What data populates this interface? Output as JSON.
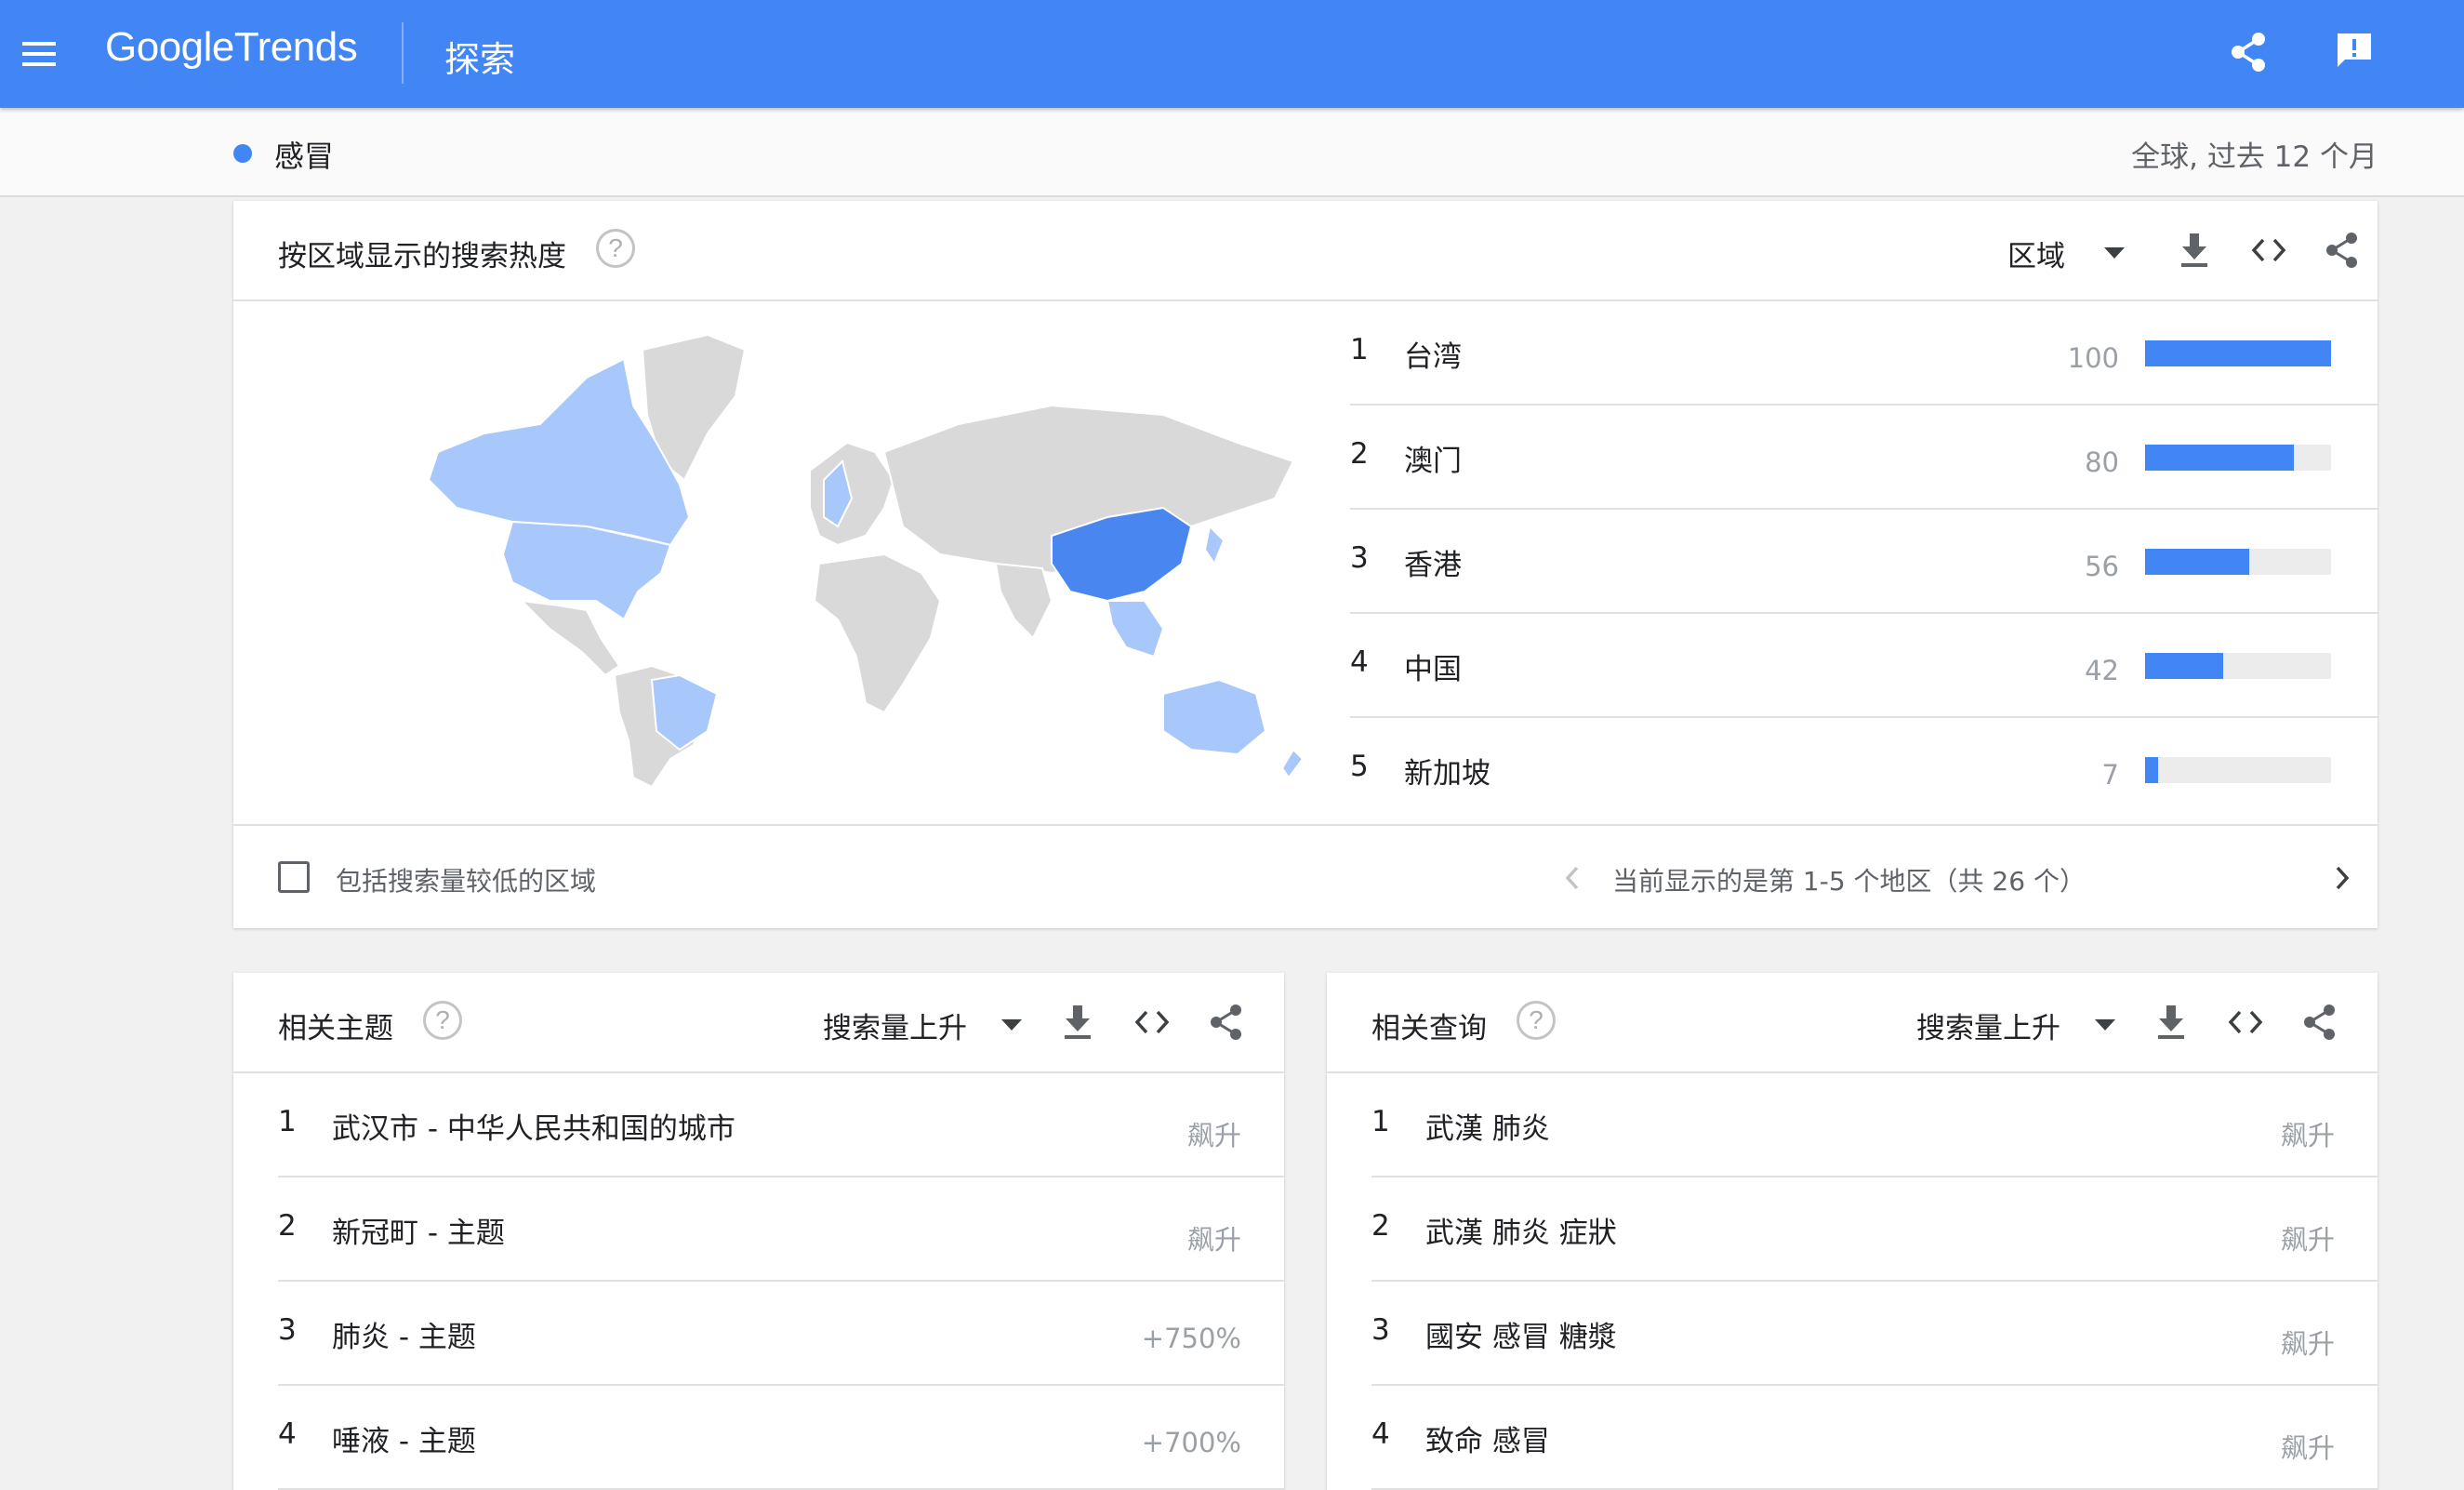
{
  "header": {
    "logo_google": "Google",
    "logo_trends": "Trends",
    "page_title": "探索"
  },
  "comparison": {
    "term": "感冒",
    "term_color": "#4285f4",
    "scope": "全球, 过去 12 个月"
  },
  "region_card": {
    "title": "按区域显示的搜索热度",
    "help": "?",
    "resolution": "区域",
    "map_colors": {
      "high": "#4a86f0",
      "low": "#a8c7fa",
      "none": "#d9d9d9"
    },
    "rows": [
      {
        "rank": "1",
        "name": "台湾",
        "value": "100",
        "level": 100
      },
      {
        "rank": "2",
        "name": "澳门",
        "value": "80",
        "level": 80
      },
      {
        "rank": "3",
        "name": "香港",
        "value": "56",
        "level": 56
      },
      {
        "rank": "4",
        "name": "中国",
        "value": "42",
        "level": 42
      },
      {
        "rank": "5",
        "name": "新加坡",
        "value": "7",
        "level": 7
      }
    ],
    "include_low_volume": "包括搜索量较低的区域",
    "pager": "当前显示的是第 1-5 个地区（共 26 个）"
  },
  "topics_card": {
    "title": "相关主题",
    "help": "?",
    "sort": "搜索量上升",
    "rows": [
      {
        "rank": "1",
        "text": "武汉市 - 中华人民共和国的城市",
        "value": "飙升"
      },
      {
        "rank": "2",
        "text": "新冠町 - 主题",
        "value": "飙升"
      },
      {
        "rank": "3",
        "text": "肺炎 - 主题",
        "value": "+750%"
      },
      {
        "rank": "4",
        "text": "唾液 - 主题",
        "value": "+700%"
      }
    ]
  },
  "queries_card": {
    "title": "相关查询",
    "help": "?",
    "sort": "搜索量上升",
    "rows": [
      {
        "rank": "1",
        "text": "武漢 肺炎",
        "value": "飙升"
      },
      {
        "rank": "2",
        "text": "武漢 肺炎 症狀",
        "value": "飙升"
      },
      {
        "rank": "3",
        "text": "國安 感冒 糖漿",
        "value": "飙升"
      },
      {
        "rank": "4",
        "text": "致命 感冒",
        "value": "飙升"
      }
    ]
  }
}
